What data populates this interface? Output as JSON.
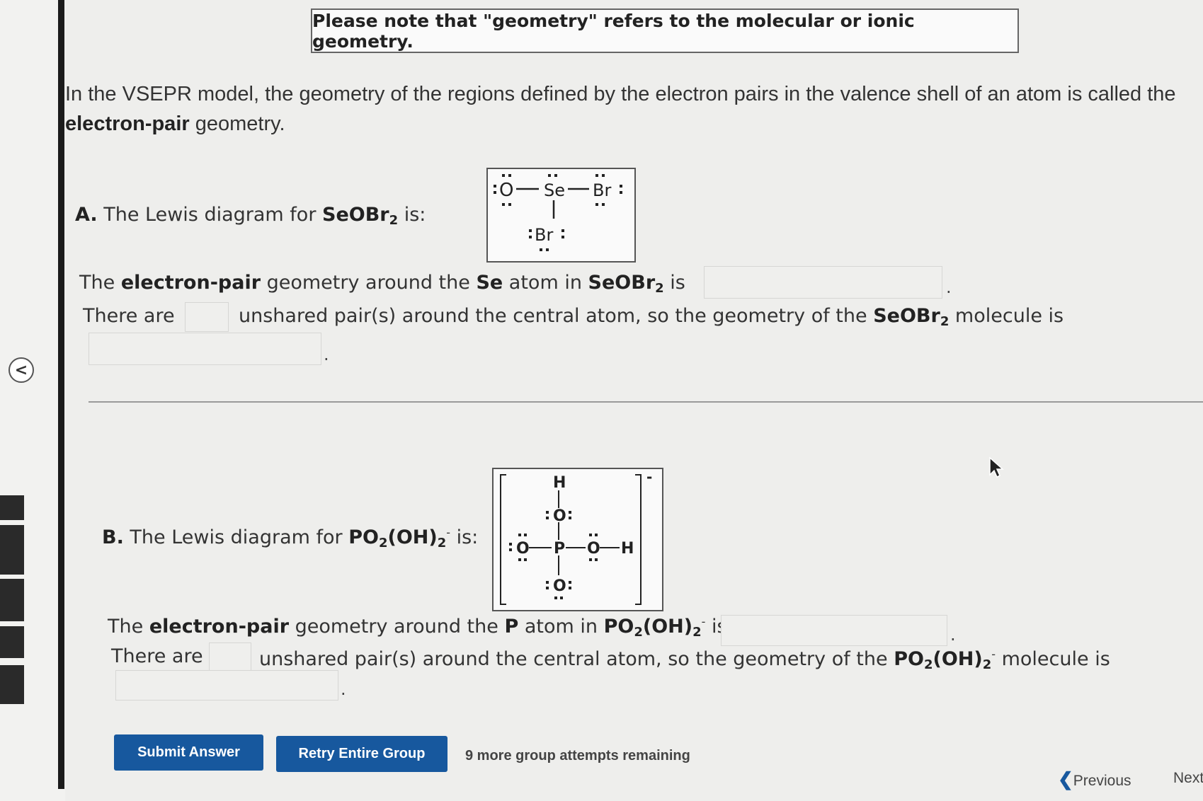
{
  "note": "Please note that \"geometry\" refers to the molecular or ionic geometry.",
  "intro": {
    "text_before": "In the VSEPR model, the geometry of the regions defined by the electron pairs in the valence shell of an atom is called the",
    "bold": "electron-pair",
    "text_after": " geometry."
  },
  "partA": {
    "letter": "A.",
    "prompt": " The Lewis diagram for ",
    "formula_main": "SeOBr",
    "formula_sub": "2",
    "prompt_end": " is:",
    "line1_a": "The ",
    "line1_bold": "electron-pair",
    "line1_b": " geometry around the ",
    "line1_atom": "Se",
    "line1_c": " atom in ",
    "line1_end": " is",
    "line2_a": "There are",
    "line2_b": "unshared pair(s) around the central atom, so the geometry of the ",
    "line2_end": " molecule is",
    "lewis": {
      "O": "O",
      "Se": "Se",
      "Br1": "Br",
      "Br2": "Br",
      "colon": ":"
    }
  },
  "partB": {
    "letter": "B.",
    "prompt": " The Lewis diagram for ",
    "formula_a": "PO",
    "formula_sub1": "2",
    "formula_b": "(OH)",
    "formula_sub2": "2",
    "formula_sup": "-",
    "prompt_end": " is:",
    "line1_a": "The ",
    "line1_bold": "electron-pair",
    "line1_b": " geometry around the ",
    "line1_atom": "P",
    "line1_c": " atom in ",
    "line1_end": " is",
    "line2_a": "There are",
    "line2_b": "unshared pair(s) around the central atom, so the geometry of the ",
    "line2_end": " molecule is",
    "lewis": {
      "H": "H",
      "O": "O",
      "P": "P",
      "charge": "-"
    }
  },
  "inputs": {
    "a_epg": "",
    "a_pairs": "",
    "a_mg": "",
    "b_epg": "",
    "b_pairs": "",
    "b_mg": ""
  },
  "buttons": {
    "submit": "Submit Answer",
    "retry": "Retry Entire Group"
  },
  "attempts": "9 more group attempts remaining",
  "nav": {
    "previous": "Previous",
    "next": "Next"
  },
  "collapse_icon": "<",
  "period": "."
}
